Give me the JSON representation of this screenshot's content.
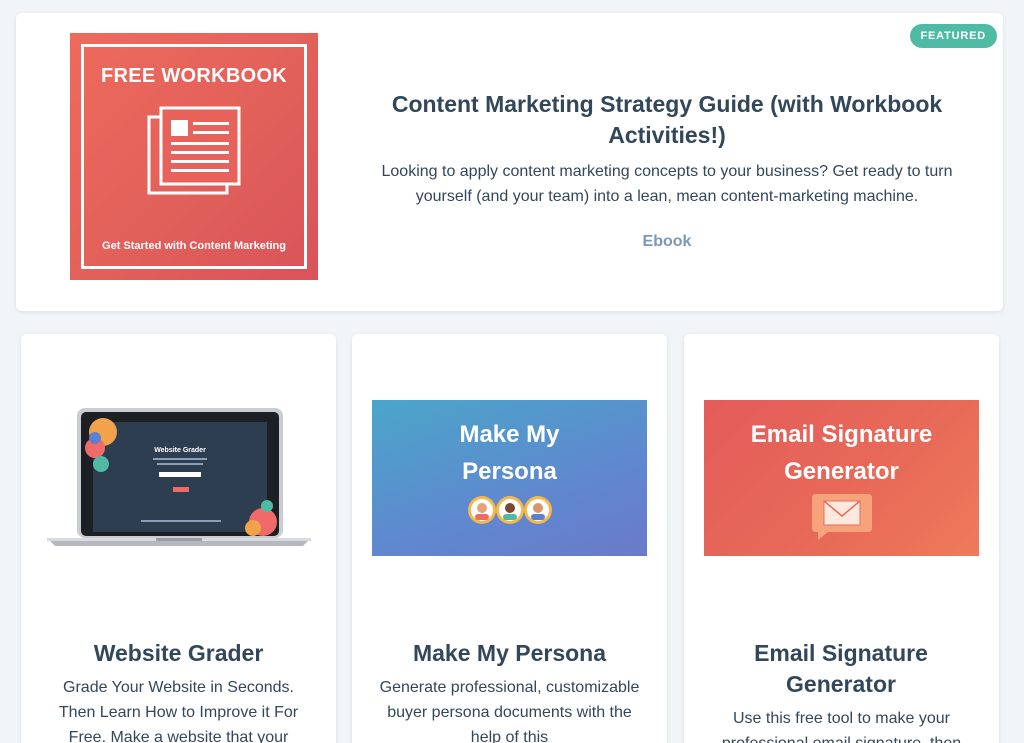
{
  "featured": {
    "badge": "FEATURED",
    "cover": {
      "title": "FREE WORKBOOK",
      "subtitle": "Get Started with Content Marketing"
    },
    "title": "Content Marketing Strategy Guide (with Workbook Activities!)",
    "description": "Looking to apply content marketing concepts to your business? Get ready to turn yourself (and your team) into a lean, mean content-marketing machine.",
    "type": "Ebook"
  },
  "cards": [
    {
      "screen_title": "Website Grader",
      "title": "Website Grader",
      "description": "Grade Your Website in Seconds. Then Learn How to Improve it For Free. Make a website that your"
    },
    {
      "tile_text": "Make My Persona",
      "title": "Make My Persona",
      "description": "Generate professional, customizable buyer persona documents with the help of this"
    },
    {
      "tile_text": "Email Signature Generator",
      "title": "Email Signature Generator",
      "description": "Use this free tool to make your professional email signature, then"
    }
  ],
  "colors": {
    "badge": "#4fbba5",
    "cover": "#e1605a",
    "persona_tile": "#5f88cf",
    "email_tile": "#e86a58",
    "text": "#33475b",
    "type_label": "#7c98b6"
  }
}
